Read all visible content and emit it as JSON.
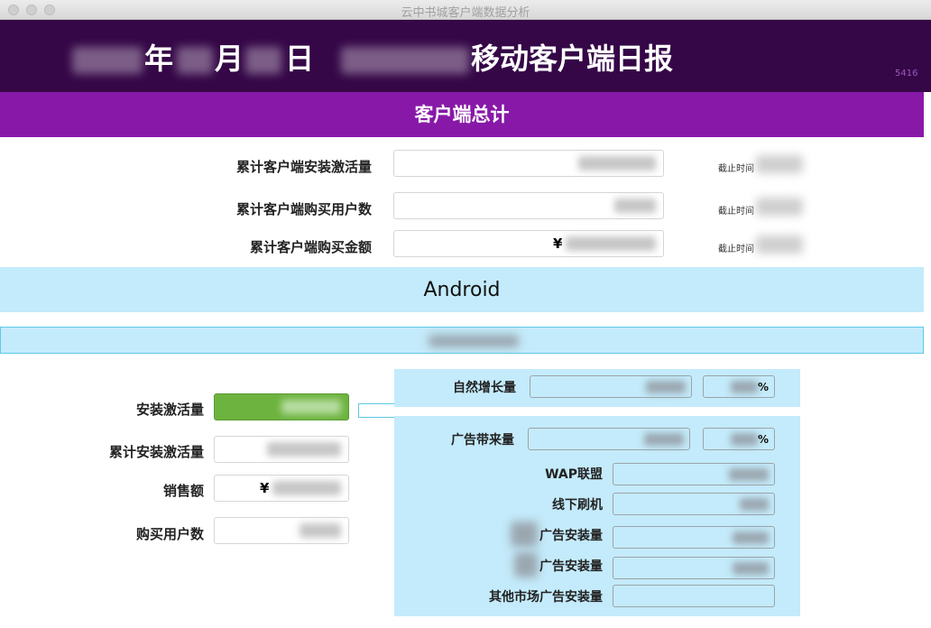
{
  "window": {
    "title": "云中书城客户端数据分析"
  },
  "header": {
    "year_suffix": "年",
    "month_suffix": "月",
    "day_suffix": "日",
    "report_title": "移动客户端日报",
    "code": "5416"
  },
  "totals": {
    "title": "客户端总计",
    "rows": [
      {
        "label": "累计客户端安装激活量",
        "prefix": "",
        "note": "截止时间"
      },
      {
        "label": "累计客户端购买用户数",
        "prefix": "",
        "note": "截止时间"
      },
      {
        "label": "累计客户端购买金额",
        "prefix": "¥",
        "note": "截止时间"
      }
    ]
  },
  "android": {
    "title": "Android",
    "left_fields": [
      {
        "label": "安装激活量",
        "prefix": ""
      },
      {
        "label": "累计安装激活量",
        "prefix": ""
      },
      {
        "label": "销售额",
        "prefix": "¥"
      },
      {
        "label": "购买用户数",
        "prefix": ""
      }
    ],
    "natural_growth": {
      "label": "自然增长量",
      "pct_suffix": "%"
    },
    "ad_volume": {
      "label": "广告带来量",
      "pct_suffix": "%"
    },
    "ad_sources": [
      {
        "label": "WAP联盟"
      },
      {
        "label": "线下刷机"
      },
      {
        "label": "广告安装量"
      },
      {
        "label": "广告安装量"
      },
      {
        "label": "其他市场广告安装量"
      }
    ]
  },
  "colors": {
    "header_bg": "#350747",
    "totals_bar": "#8819a8",
    "android_bar": "#c4ebfb",
    "active_field": "#6db33f"
  }
}
